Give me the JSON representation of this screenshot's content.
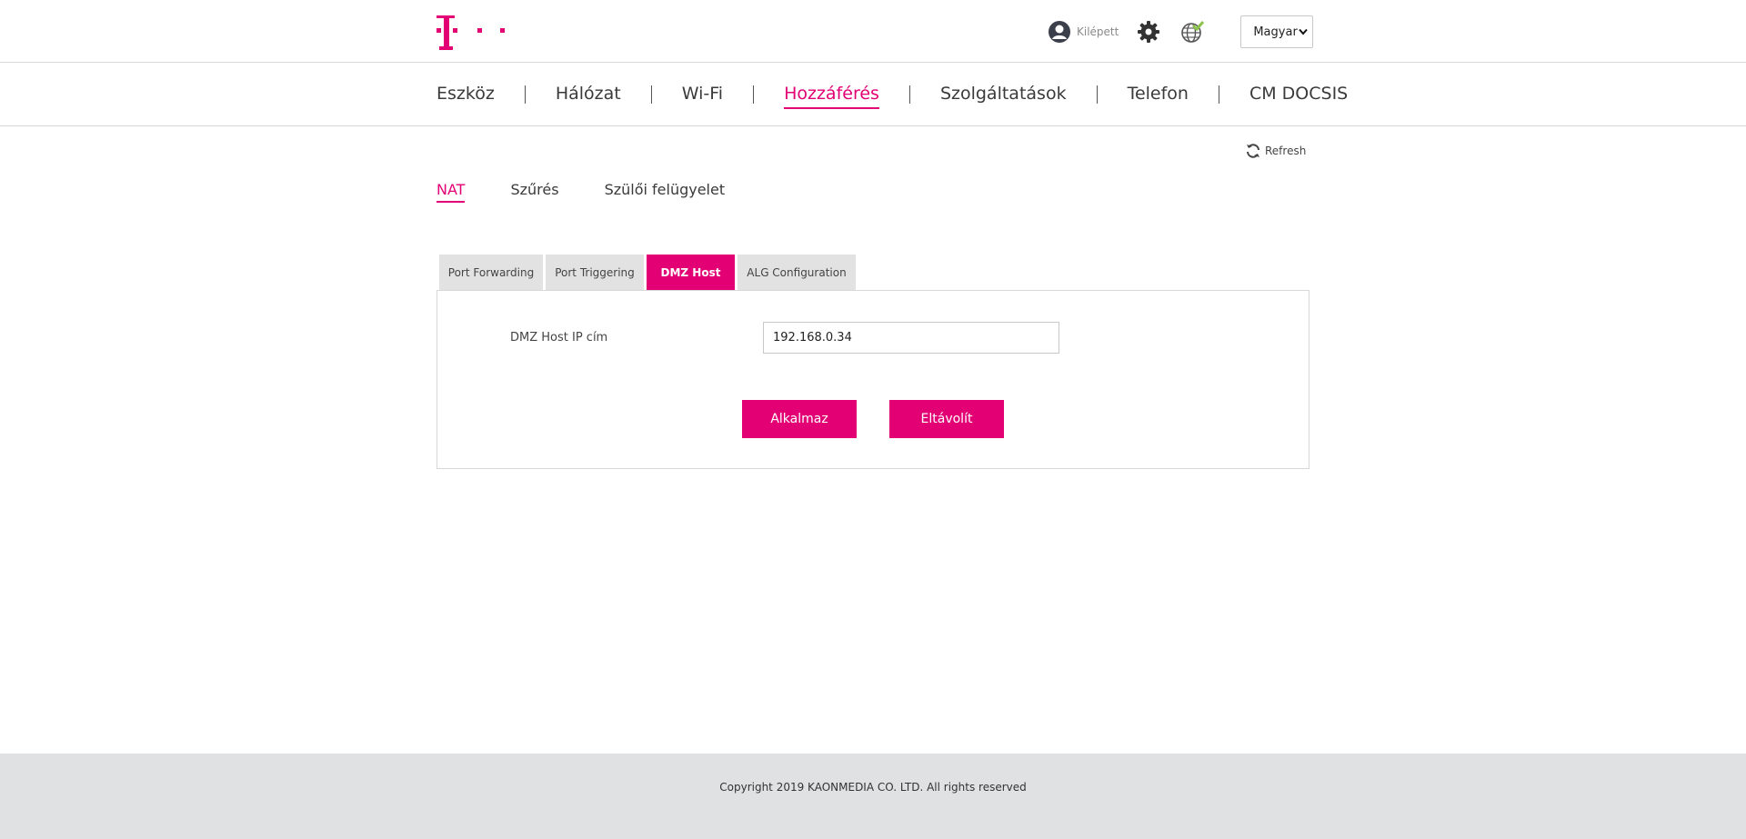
{
  "brand": {
    "accent_color": "#e20074",
    "logo_icon": "telekom-t-logo"
  },
  "header": {
    "user_icon": "user-icon",
    "logout_label": "Kilépett",
    "settings_icon": "gear-icon",
    "network_icon": "globe-check-icon",
    "language": {
      "selected": "Magyar"
    }
  },
  "main_nav": {
    "items": [
      {
        "label": "Eszköz"
      },
      {
        "label": "Hálózat"
      },
      {
        "label": "Wi-Fi"
      },
      {
        "label": "Hozzáférés",
        "active": true
      },
      {
        "label": "Szolgáltatások"
      },
      {
        "label": "Telefon"
      },
      {
        "label": "CM DOCSIS"
      }
    ]
  },
  "refresh": {
    "label": "Refresh"
  },
  "sub_nav": {
    "items": [
      {
        "label": "NAT",
        "active": true
      },
      {
        "label": "Szűrés"
      },
      {
        "label": "Szülői felügyelet"
      }
    ]
  },
  "tabs": {
    "items": [
      {
        "label": "Port Forwarding"
      },
      {
        "label": "Port Triggering"
      },
      {
        "label": "DMZ Host",
        "active": true
      },
      {
        "label": "ALG Configuration"
      }
    ]
  },
  "dmz": {
    "ip_label": "DMZ Host IP cím",
    "ip_value": "192.168.0.34",
    "apply_label": "Alkalmaz",
    "remove_label": "Eltávolít"
  },
  "footer": {
    "copyright": "Copyright 2019 KAONMEDIA CO. LTD. All rights reserved"
  }
}
